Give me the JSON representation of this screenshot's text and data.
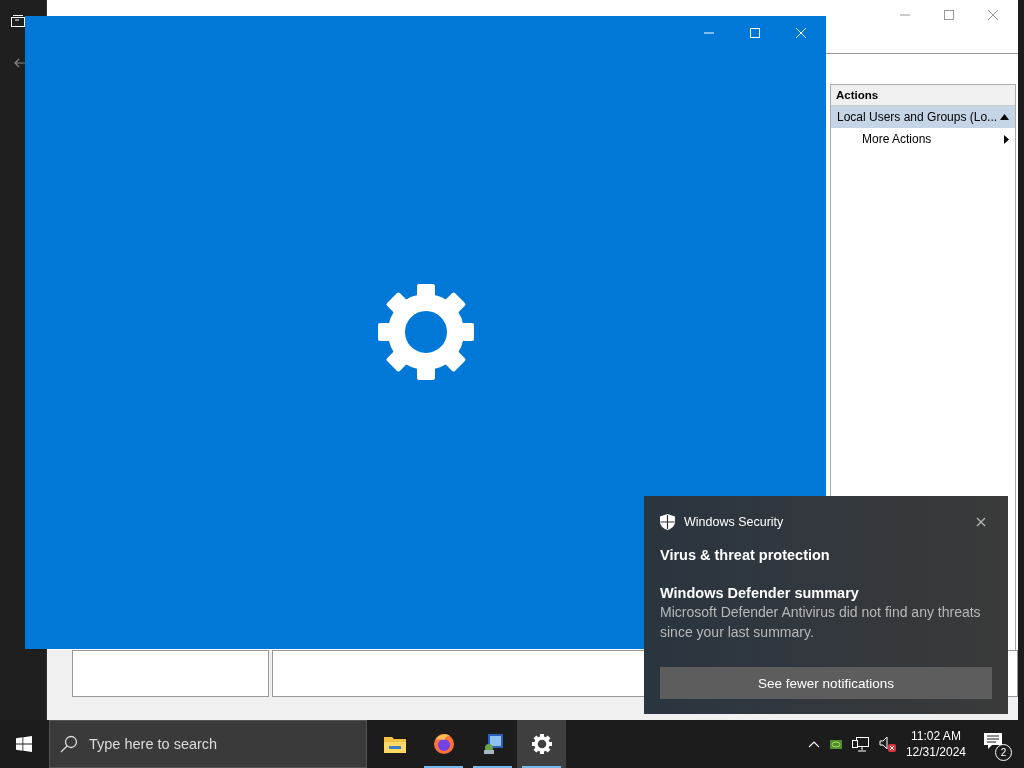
{
  "background_window": {
    "actions_pane": {
      "title": "Actions",
      "items": [
        {
          "label": "Local Users and Groups (Lo...",
          "kind": "group",
          "expanded": true
        },
        {
          "label": "More Actions",
          "kind": "submenu"
        }
      ]
    }
  },
  "notification": {
    "app": "Windows Security",
    "title": "Virus & threat protection",
    "heading": "Windows Defender summary",
    "body": "Microsoft Defender Antivirus did not find any threats since your last summary.",
    "button": "See fewer notifications"
  },
  "taskbar": {
    "search": {
      "placeholder": "Type here to search"
    },
    "apps": [
      {
        "kind": "folder",
        "running": false,
        "selected": false
      },
      {
        "kind": "firefox",
        "running": true,
        "selected": false
      },
      {
        "kind": "mmc",
        "running": true,
        "selected": false
      },
      {
        "kind": "settings",
        "running": true,
        "selected": true
      }
    ],
    "tray": {
      "volume_muted": true,
      "time": "11:02 AM",
      "date": "12/31/2024",
      "notification_count": "2"
    }
  }
}
